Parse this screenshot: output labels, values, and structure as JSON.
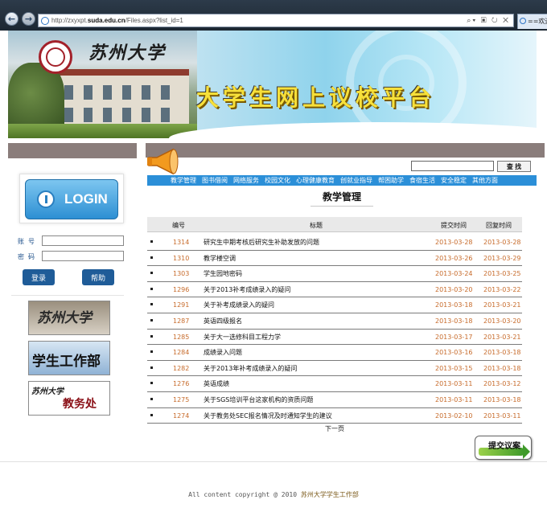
{
  "browser": {
    "url_prefix": "http://zxyxpt.",
    "url_host": "suda.edu.cn",
    "url_suffix": "/Files.aspx?list_id=1",
    "tab_title": "==欢迎"
  },
  "banner": {
    "university": "苏州大学",
    "platform_title": "大学生网上议校平台"
  },
  "login": {
    "login_label": "LOGIN",
    "account_label": "账号",
    "password_label": "密码",
    "login_button": "登录",
    "help_button": "帮助"
  },
  "side_links": {
    "university": "苏州大学",
    "student_affairs": "学生工作部",
    "academic_affairs_logo": "苏州大学",
    "academic_affairs": "教务处"
  },
  "search": {
    "button": "查 找"
  },
  "nav": [
    "教学管理",
    "图书借阅",
    "网络服务",
    "校园文化",
    "心理健康教育",
    "创就业指导",
    "帮困助学",
    "食宿生活",
    "安全稳定",
    "其他方面"
  ],
  "section_title": "教学管理",
  "table": {
    "headers": {
      "no": "编号",
      "title": "标题",
      "submit_time": "提交时间",
      "reply_time": "回复时间"
    },
    "rows": [
      {
        "no": "1314",
        "title": "研究生中期考核后研究生补助发放的问题",
        "submit": "2013-03-28",
        "reply": "2013-03-28"
      },
      {
        "no": "1310",
        "title": "教学楼空调",
        "submit": "2013-03-26",
        "reply": "2013-03-29"
      },
      {
        "no": "1303",
        "title": "学生园地密码",
        "submit": "2013-03-24",
        "reply": "2013-03-25"
      },
      {
        "no": "1296",
        "title": "关于2013补考成绩录入的疑问",
        "submit": "2013-03-20",
        "reply": "2013-03-22"
      },
      {
        "no": "1291",
        "title": "关于补考成绩录入的疑问",
        "submit": "2013-03-18",
        "reply": "2013-03-21"
      },
      {
        "no": "1287",
        "title": "英语四级报名",
        "submit": "2013-03-18",
        "reply": "2013-03-20"
      },
      {
        "no": "1285",
        "title": "关于大一选修科目工程力学",
        "submit": "2013-03-17",
        "reply": "2013-03-21"
      },
      {
        "no": "1284",
        "title": "成绩录入问题",
        "submit": "2013-03-16",
        "reply": "2013-03-18"
      },
      {
        "no": "1282",
        "title": "关于2013年补考成绩录入的疑问",
        "submit": "2013-03-15",
        "reply": "2013-03-18"
      },
      {
        "no": "1276",
        "title": "英语成绩",
        "submit": "2013-03-11",
        "reply": "2013-03-12"
      },
      {
        "no": "1275",
        "title": "关于SGS培训平台这家机构的资质问题",
        "submit": "2013-03-11",
        "reply": "2013-03-18"
      },
      {
        "no": "1274",
        "title": "关于教务处SEC报名情况及时通知学生的建议",
        "submit": "2013-02-10",
        "reply": "2013-03-11"
      }
    ]
  },
  "pagination": {
    "next": "下一页"
  },
  "submit_suggestion": "提交议案",
  "footer": {
    "copyright": "All  content  copyright @ 2010",
    "org": "苏州大学学生工作部"
  }
}
